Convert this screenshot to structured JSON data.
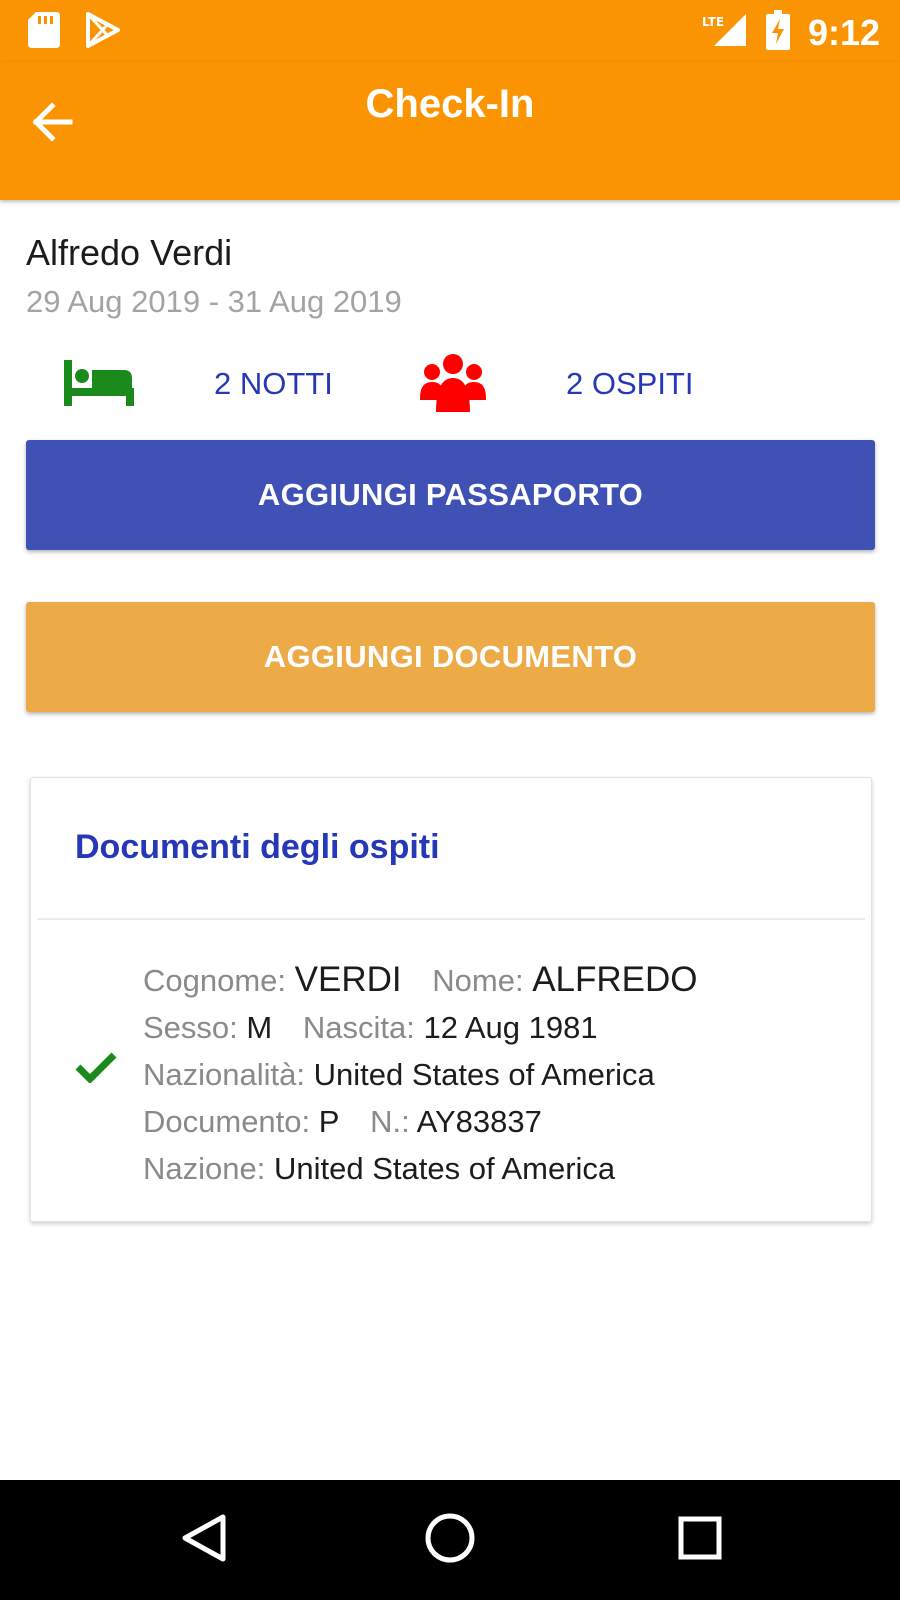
{
  "status_bar": {
    "time": "9:12",
    "network_label": "LTE",
    "icons": [
      "sd-card-icon",
      "play-store-icon",
      "lte-signal-icon",
      "battery-charging-icon"
    ]
  },
  "app_bar": {
    "title": "Check-In",
    "back_icon": "arrow-left-icon",
    "background_color": "#fb9403"
  },
  "booking": {
    "guest_name": "Alfredo Verdi",
    "date_range": "29 Aug 2019 - 31 Aug 2019",
    "nights_label": "2 NOTTI",
    "guests_label": "2 OSPITI",
    "nights_icon": "bed-icon",
    "guests_icon": "people-group-icon",
    "bed_icon_color": "#1a8a1a",
    "guests_icon_color": "#ff0000",
    "label_color": "#2638b5"
  },
  "actions": {
    "add_passport_label": "AGGIUNGI PASSAPORTO",
    "add_passport_color": "#3f51b5",
    "add_document_label": "AGGIUNGI DOCUMENTO",
    "add_document_color": "#edab48"
  },
  "documents_card": {
    "title": "Documenti degli ospiti",
    "entries": [
      {
        "status_icon": "checkmark-icon",
        "status_color": "#1a8a1a",
        "surname_label": "Cognome:",
        "surname": "VERDI",
        "name_label": "Nome:",
        "name": "ALFREDO",
        "sex_label": "Sesso:",
        "sex": "M",
        "birth_label": "Nascita:",
        "birth": "12 Aug 1981",
        "nationality_label": "Nazionalità:",
        "nationality": "United States of America",
        "doc_type_label": "Documento:",
        "doc_type": "P",
        "doc_number_label": "N.:",
        "doc_number": "AY83837",
        "country_label": "Nazione:",
        "country": "United States of America"
      }
    ]
  },
  "nav_bar": {
    "icons": [
      "nav-back-icon",
      "nav-home-icon",
      "nav-recents-icon"
    ]
  }
}
